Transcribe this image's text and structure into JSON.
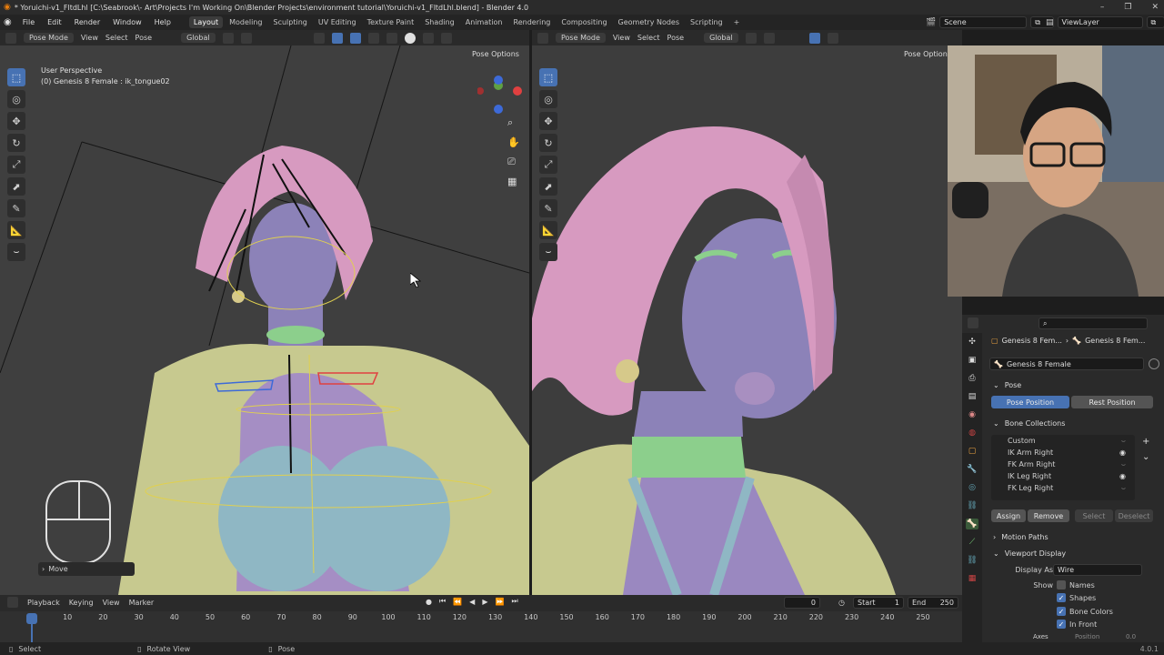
{
  "window": {
    "title": "* Yoruichi-v1_FltdLhl [C:\\Seabrook\\- Art\\Projects I'm Working On\\Blender Projects\\environment tutorial\\Yoruichi-v1_FltdLhl.blend] - Blender 4.0",
    "minimize": "–",
    "maximize": "❐",
    "close": "✕"
  },
  "menu": [
    "File",
    "Edit",
    "Render",
    "Window",
    "Help"
  ],
  "workspaces": [
    "Layout",
    "Modeling",
    "Sculpting",
    "UV Editing",
    "Texture Paint",
    "Shading",
    "Animation",
    "Rendering",
    "Compositing",
    "Geometry Nodes",
    "Scripting"
  ],
  "workspace_add": "+",
  "scene": {
    "label": "Scene",
    "view_layer": "ViewLayer"
  },
  "left_viewport": {
    "mode": "Pose Mode",
    "menus": [
      "View",
      "Select",
      "Pose"
    ],
    "orientation": "Global",
    "pose_options": "Pose Options",
    "perspective": "User Perspective",
    "object_info": "(0) Genesis 8 Female : ik_tongue02",
    "last_op": "Move",
    "tools": [
      "⬚",
      "◎",
      "✥",
      "↻",
      "⤢",
      "⬈",
      "✎",
      "📐",
      "⌣"
    ]
  },
  "right_viewport": {
    "mode": "Pose Mode",
    "menus": [
      "View",
      "Select",
      "Pose"
    ],
    "orientation": "Global",
    "pose_options": "Pose Options"
  },
  "properties": {
    "breadcrumb_object": "Genesis 8 Fem...",
    "breadcrumb_armature": "Genesis 8 Fem...",
    "data_name": "Genesis 8 Female",
    "pose_panel": "Pose",
    "pose_position": "Pose Position",
    "rest_position": "Rest Position",
    "bone_collections_panel": "Bone Collections",
    "collections": [
      {
        "name": "Custom",
        "visible": false
      },
      {
        "name": "IK Arm Right",
        "visible": true
      },
      {
        "name": "FK Arm Right",
        "visible": false
      },
      {
        "name": "IK Leg Right",
        "visible": true
      },
      {
        "name": "FK Leg Right",
        "visible": false
      }
    ],
    "assign": "Assign",
    "remove": "Remove",
    "select": "Select",
    "deselect": "Deselect",
    "motion_paths": "Motion Paths",
    "viewport_display": "Viewport Display",
    "display_as_label": "Display As",
    "display_as_value": "Wire",
    "show_label": "Show",
    "show_options": [
      {
        "name": "Names",
        "checked": false
      },
      {
        "name": "Shapes",
        "checked": true
      },
      {
        "name": "Bone Colors",
        "checked": true
      },
      {
        "name": "In Front",
        "checked": true
      }
    ],
    "axes_label": "Axes",
    "position_label": "Position",
    "position_value": "0.0"
  },
  "timeline": {
    "menus": [
      "Playback",
      "Keying",
      "View",
      "Marker"
    ],
    "current_frame": "0",
    "start_label": "Start",
    "start_value": "1",
    "end_label": "End",
    "end_value": "250",
    "ticks": [
      "0",
      "10",
      "20",
      "30",
      "40",
      "50",
      "60",
      "70",
      "80",
      "90",
      "100",
      "110",
      "120",
      "130",
      "140",
      "150",
      "160",
      "170",
      "180",
      "190",
      "200",
      "210",
      "220",
      "230",
      "240",
      "250"
    ]
  },
  "status": {
    "select": "Select",
    "rotate_view": "Rotate View",
    "pose": "Pose",
    "version": "4.0.1"
  },
  "colors": {
    "accent": "#4772b3",
    "skin": "#8c82b8",
    "hair": "#d79ac0",
    "jacket": "#c7c98f",
    "shirt": "#8fb7c4",
    "collar": "#8ccf8c"
  }
}
